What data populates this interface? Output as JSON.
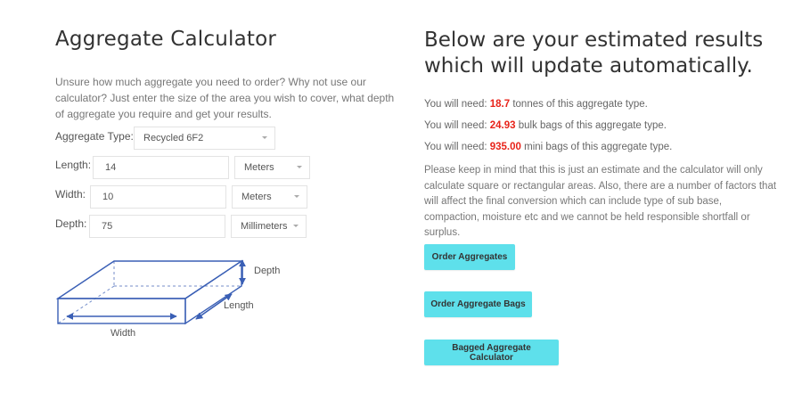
{
  "calculator": {
    "title": "Aggregate Calculator",
    "intro": "Unsure how much aggregate you need to order? Why not use our calculator? Just enter the size of the area you wish to cover, what depth of aggregate you require and get your results.",
    "aggregate_type": {
      "label": "Aggregate Type:",
      "value": "Recycled 6F2"
    },
    "length": {
      "label": "Length:",
      "value": "14",
      "unit": "Meters"
    },
    "width": {
      "label": "Width:",
      "value": "10",
      "unit": "Meters"
    },
    "depth": {
      "label": "Depth:",
      "value": "75",
      "unit": "Millimeters"
    },
    "diagram": {
      "depth_label": "Depth",
      "length_label": "Length",
      "width_label": "Width",
      "line_color": "#3a5fb5"
    }
  },
  "results": {
    "title_line1": "Below are your estimated results",
    "title_line2": "which will update automatically.",
    "highlight_color": "#e8231a",
    "tonnes": {
      "prefix": "You will need: ",
      "value": "18.7",
      "suffix": " tonnes of this aggregate type."
    },
    "bulk_bags": {
      "prefix": "You will need: ",
      "value": "24.93",
      "suffix": " bulk bags of this aggregate type."
    },
    "mini_bags": {
      "prefix": "You will need: ",
      "value": "935.00",
      "suffix": " mini bags of this aggregate type."
    },
    "disclaimer": "Please keep in mind that this is just an estimate and the calculator will only calculate square or rectangular areas. Also, there are a number of factors that will affect the final conversion which can include type of sub base, compaction, moisture etc and we cannot be held responsible shortfall or surplus."
  },
  "buttons": {
    "color": "#5ee0eb",
    "order_aggregates": "Order Aggregates",
    "order_aggregate_bags": "Order Aggregate Bags",
    "bagged_calculator": "Bagged Aggregate Calculator"
  }
}
